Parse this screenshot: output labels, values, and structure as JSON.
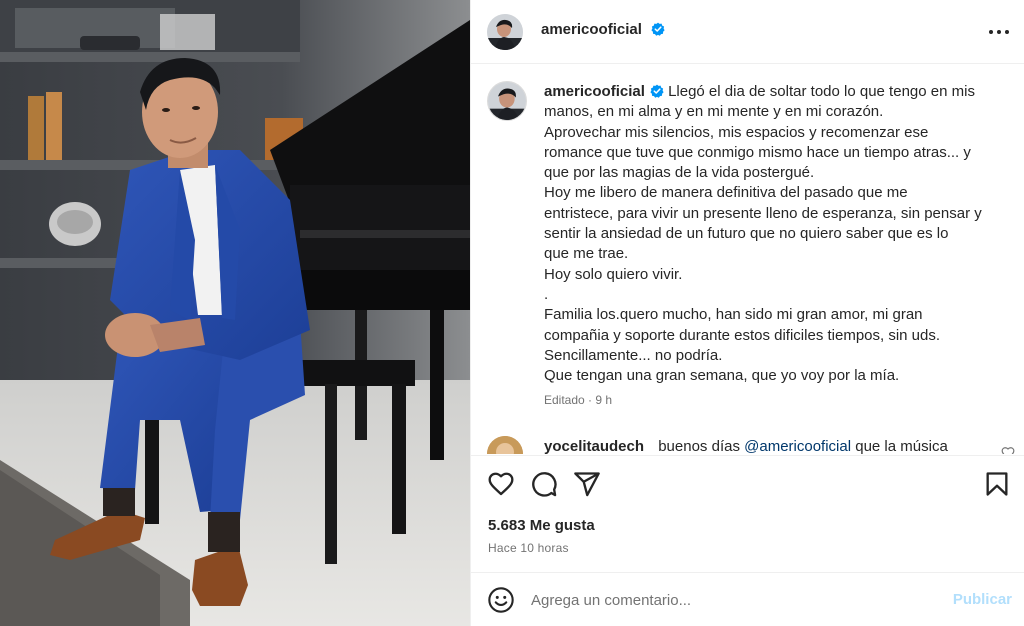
{
  "post": {
    "username": "americooficial",
    "verified": true,
    "photo_alt": "Man in blue suit seated on a piano bench beside a black grand piano"
  },
  "caption": {
    "username": "americooficial",
    "lines": [
      "Llegó el dia de soltar todo lo que tengo en mis",
      "manos, en mi alma y en mi mente y en mi corazón.",
      "Aprovechar mis silencios, mis espacios y recomenzar ese",
      "romance que tuve que conmigo mismo hace un tiempo atras... y",
      "que por las magias de la vida postergué.",
      "Hoy me libero de manera definitiva del pasado que me",
      "entristece, para vivir un presente lleno de esperanza, sin pensar y",
      "sentir la ansiedad de un futuro que no quiero saber que es lo",
      "que me trae.",
      "Hoy solo quiero vivir.",
      ".",
      "Familia los.quero mucho, han sido mi gran amor, mi gran",
      "compañia y soporte durante estos dificiles tiempos, sin uds.",
      "Sencillamente... no podría.",
      "Que tengan una gran semana, que yo voy por la mía."
    ],
    "edited_label": "Editado",
    "separator": "·",
    "age": "9 h"
  },
  "comments": [
    {
      "username": "yocelitaudech",
      "text_before": "buenos días",
      "mention": "@americooficial",
      "text_after": "que la música"
    }
  ],
  "stats": {
    "likes": "5.683 Me gusta",
    "posted": "Hace 10 horas"
  },
  "composer": {
    "placeholder": "Agrega un comentario...",
    "publish_label": "Publicar"
  },
  "icons": {
    "verified": "verified-badge-icon",
    "more": "more-options-icon",
    "like": "heart-icon",
    "comment": "comment-icon",
    "share": "share-icon",
    "save": "bookmark-icon",
    "emoji": "emoji-icon"
  },
  "colors": {
    "verified_blue": "#0095f6",
    "text": "#262626",
    "secondary": "#737373",
    "mention": "#00376b",
    "publish_disabled": "#b2dffc",
    "border": "#efefef"
  }
}
